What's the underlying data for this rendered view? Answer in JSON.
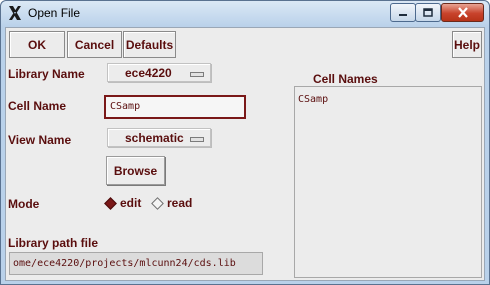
{
  "window": {
    "title": "Open File",
    "icon": "x-logo-icon",
    "controls": [
      "minimize-icon",
      "maximize-icon",
      "close-icon"
    ]
  },
  "toolbar": {
    "ok_label": "OK",
    "cancel_label": "Cancel",
    "defaults_label": "Defaults",
    "help_label": "Help"
  },
  "form": {
    "library_name_label": "Library Name",
    "library_name_value": "ece4220",
    "cell_name_label": "Cell Name",
    "cell_name_value": "CSamp",
    "view_name_label": "View Name",
    "view_name_value": "schematic",
    "browse_label": "Browse",
    "mode_label": "Mode",
    "mode_options": [
      {
        "label": "edit",
        "selected": true
      },
      {
        "label": "read",
        "selected": false
      }
    ],
    "library_path_label": "Library path file",
    "library_path_value": "ome/ece4220/projects/mlcunn24/cds.lib"
  },
  "cell_names": {
    "header": "Cell Names",
    "items": [
      "CSamp"
    ]
  },
  "colors": {
    "label_text": "#5a0e0e",
    "field_border": "#7a1818",
    "panel_bg": "#ececec",
    "window_frame": "#b9d1ea"
  }
}
